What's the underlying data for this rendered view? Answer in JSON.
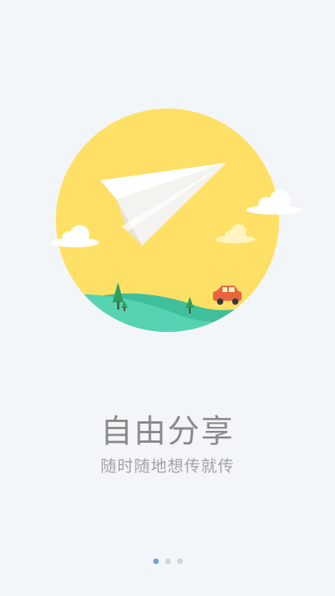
{
  "onboarding": {
    "title": "自由分享",
    "subtitle": "随时随地想传就传",
    "page_indicator": {
      "total": 3,
      "active_index": 0
    },
    "colors": {
      "background": "#f3f6f9",
      "sun": "#ffe066",
      "hill": "#4ecdac",
      "car": "#e8643f",
      "tree": "#2e9e5e",
      "active_dot": "#6fa3d6",
      "inactive_dot": "#d0d4d8"
    }
  }
}
